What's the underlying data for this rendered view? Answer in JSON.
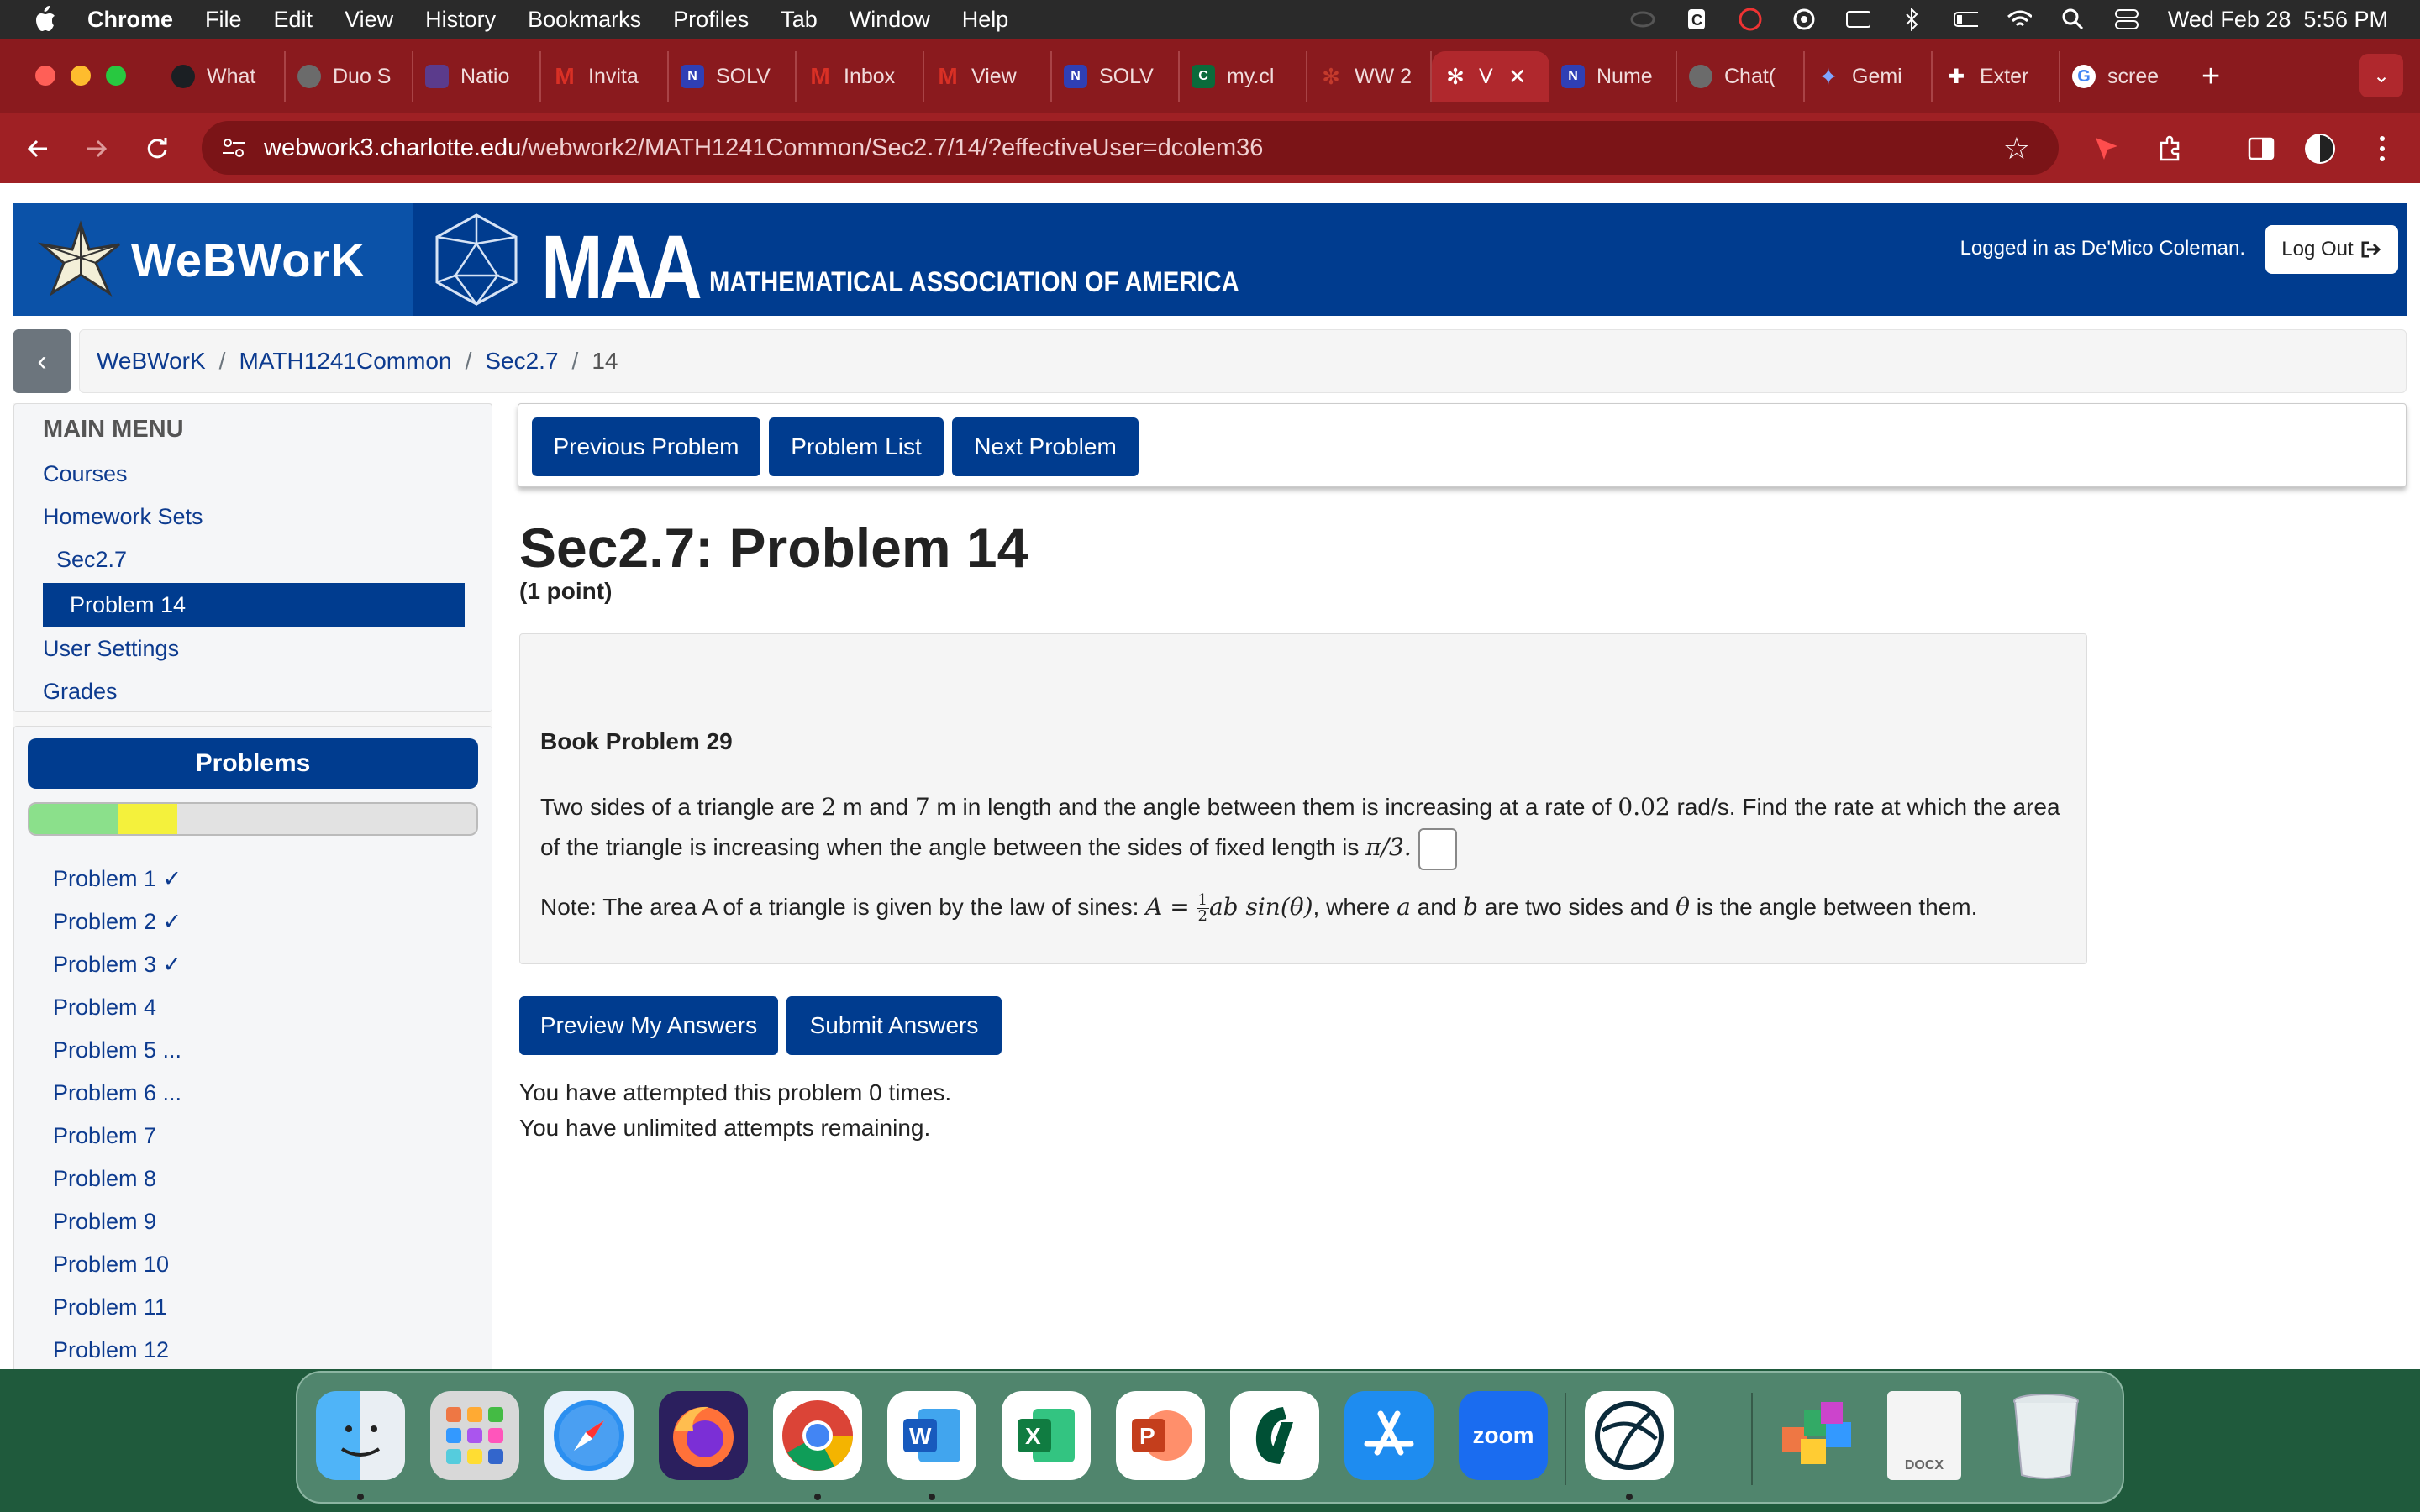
{
  "menubar": {
    "app": "Chrome",
    "items": [
      "File",
      "Edit",
      "View",
      "History",
      "Bookmarks",
      "Profiles",
      "Tab",
      "Window",
      "Help"
    ],
    "clock": "Wed Feb 28  5:56 PM"
  },
  "browser": {
    "tabs": [
      {
        "title": "What",
        "icon": "github-icon",
        "color": "#1b1f23"
      },
      {
        "title": "Duo S",
        "icon": "duo-icon",
        "color": "#6b6b6b"
      },
      {
        "title": "Natio",
        "icon": "site-icon",
        "color": "#5b3b8c"
      },
      {
        "title": "Invita",
        "icon": "gmail-icon",
        "color": "#d93025"
      },
      {
        "title": "SOLV",
        "icon": "n-icon",
        "color": "#2f3fb5"
      },
      {
        "title": "Inbox",
        "icon": "gmail-icon",
        "color": "#d93025"
      },
      {
        "title": "View",
        "icon": "gmail-icon",
        "color": "#d93025"
      },
      {
        "title": "SOLV",
        "icon": "n-icon",
        "color": "#2f3fb5"
      },
      {
        "title": "my.cl",
        "icon": "charlotte-icon",
        "color": "#0a6b3b"
      },
      {
        "title": "WW 2",
        "icon": "webwork-icon",
        "color": "#c43a2c"
      },
      {
        "title": "V",
        "icon": "webwork-icon",
        "color": "#c43a2c",
        "active": true
      },
      {
        "title": "Nume",
        "icon": "n-icon",
        "color": "#2f3fb5"
      },
      {
        "title": "Chat(",
        "icon": "chatgpt-icon",
        "color": "#6b6b6b"
      },
      {
        "title": "Gemi",
        "icon": "gemini-icon",
        "color": "#3b6fe0"
      },
      {
        "title": "Exter",
        "icon": "puzzle-icon",
        "color": "#444"
      },
      {
        "title": "scree",
        "icon": "google-icon",
        "color": "#ffffff"
      }
    ],
    "url_host": "webwork3.charlotte.edu",
    "url_path": "/webwork2/MATH1241Common/Sec2.7/14/?effectiveUser=dcolem36"
  },
  "header": {
    "logo_text": "WeBWorK",
    "maa_big": "MAA",
    "maa_full": "MATHEMATICAL ASSOCIATION OF AMERICA",
    "login_text": "Logged in as De'Mico Coleman.",
    "logout_label": "Log Out"
  },
  "breadcrumb": {
    "items": [
      "WeBWorK",
      "MATH1241Common",
      "Sec2.7"
    ],
    "current": "14"
  },
  "sidebar": {
    "main_menu_title": "MAIN MENU",
    "courses": "Courses",
    "homework_sets": "Homework Sets",
    "set": "Sec2.7",
    "active_problem": "Problem 14",
    "user_settings": "User Settings",
    "grades": "Grades",
    "problems_title": "Problems",
    "progress": {
      "correct_fraction": 0.2,
      "partial_fraction": 0.13
    },
    "problems": [
      "Problem 1 ✓",
      "Problem 2 ✓",
      "Problem 3 ✓",
      "Problem 4",
      "Problem 5 ...",
      "Problem 6 ...",
      "Problem 7",
      "Problem 8",
      "Problem 9",
      "Problem 10",
      "Problem 11",
      "Problem 12"
    ]
  },
  "nav_buttons": {
    "previous": "Previous Problem",
    "list": "Problem List",
    "next": "Next Problem"
  },
  "problem": {
    "title": "Sec2.7: Problem 14",
    "points": "(1 point)",
    "book": "Book Problem 29",
    "text_1": "Two sides of a triangle are ",
    "side_a": "2",
    "text_2": " m and ",
    "side_b": "7",
    "text_3": " m in length and the angle between them is increasing at a rate of ",
    "rate": "0.02",
    "text_4": " rad/s. Find the rate at which the area of the triangle is increasing when the angle between the sides of fixed length is ",
    "angle": "π/3.",
    "note_1": "Note: The area A of a triangle is given by the law of sines: ",
    "formula_lhs": "A =",
    "frac_num": "1",
    "frac_den": "2",
    "formula_rhs": "ab sin(θ)",
    "note_2": ", where ",
    "var_a": "a",
    "note_3": " and ",
    "var_b": "b",
    "note_4": " are two sides and ",
    "var_theta": "θ",
    "note_5": " is the angle between them."
  },
  "answer_buttons": {
    "preview": "Preview My Answers",
    "submit": "Submit Answers"
  },
  "attempts": {
    "line1": "You have attempted this problem 0 times.",
    "line2": "You have unlimited attempts remaining."
  },
  "dock": {
    "apps": [
      {
        "name": "finder-icon",
        "color": "#2f8fe8"
      },
      {
        "name": "launchpad-icon",
        "color": "#d8d8d8"
      },
      {
        "name": "safari-icon",
        "color": "#e8f2fb"
      },
      {
        "name": "firefox-icon",
        "color": "#2b1f5e"
      },
      {
        "name": "chrome-icon",
        "color": "#ffffff"
      },
      {
        "name": "word-icon",
        "color": "#ffffff",
        "label": "W"
      },
      {
        "name": "excel-icon",
        "color": "#ffffff",
        "label": "X"
      },
      {
        "name": "powerpoint-icon",
        "color": "#ffffff",
        "label": "P"
      },
      {
        "name": "charlotte-icon",
        "color": "#ffffff"
      },
      {
        "name": "app-store-icon",
        "color": "#1e8cf0"
      },
      {
        "name": "zoom-icon",
        "color": "#1a6cf0",
        "label": "zoom"
      },
      {
        "name": "worldwide-icon",
        "color": "#ffffff"
      },
      {
        "name": "office-files-icon",
        "color": "#ffffff"
      },
      {
        "name": "docx-file-icon",
        "color": "#f4f4f4",
        "label": "DOCX"
      },
      {
        "name": "trash-icon",
        "color": "#e8eef0"
      }
    ]
  }
}
